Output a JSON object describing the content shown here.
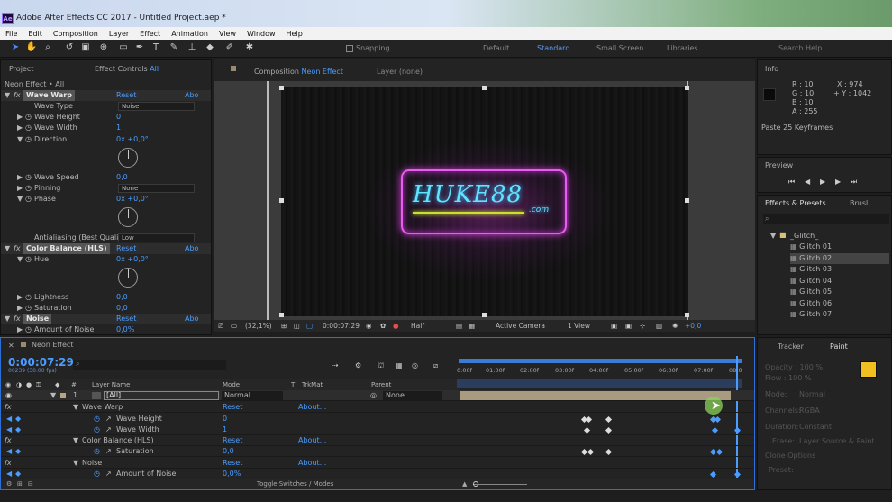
{
  "titlebar": {
    "title": "Adobe After Effects CC 2017 - Untitled Project.aep *",
    "logo": "Ae"
  },
  "menu": [
    "File",
    "Edit",
    "Composition",
    "Layer",
    "Effect",
    "Animation",
    "View",
    "Window",
    "Help"
  ],
  "toolbar": {
    "snapping": "Snapping",
    "workspaces": [
      "Default",
      "Standard",
      "Small Screen",
      "Libraries"
    ],
    "search": "Search Help"
  },
  "project_panel": {
    "tab_project": "Project",
    "tab_effect_controls": "Effect Controls",
    "effect_controls_target": "All",
    "breadcrumb": "Neon Effect • All"
  },
  "effects": {
    "wave_warp": {
      "name": "Wave Warp",
      "reset": "Reset",
      "about": "Abo",
      "wave_type_label": "Wave Type",
      "wave_type_value": "Noise",
      "wave_height_label": "Wave Height",
      "wave_height_value": "0",
      "wave_width_label": "Wave Width",
      "wave_width_value": "1",
      "direction_label": "Direction",
      "direction_value": "0x +0,0°",
      "wave_speed_label": "Wave Speed",
      "wave_speed_value": "0,0",
      "pinning_label": "Pinning",
      "pinning_value": "None",
      "phase_label": "Phase",
      "phase_value": "0x +0,0°",
      "antialiasing_label": "Antialiasing (Best Quali",
      "antialiasing_value": "Low"
    },
    "color_balance": {
      "name": "Color Balance (HLS)",
      "reset": "Reset",
      "about": "Abo",
      "hue_label": "Hue",
      "hue_value": "0x +0,0°",
      "lightness_label": "Lightness",
      "lightness_value": "0,0",
      "saturation_label": "Saturation",
      "saturation_value": "0,0"
    },
    "noise": {
      "name": "Noise",
      "reset": "Reset",
      "about": "Abo",
      "amount_label": "Amount of Noise",
      "amount_value": "0,0%"
    }
  },
  "composition": {
    "tab_label": "Composition",
    "comp_name": "Neon Effect",
    "layer_tab": "Layer (none)",
    "neon_text": "HUKE88",
    "neon_sub": ".com"
  },
  "viewer_bar": {
    "zoom": "(32,1%)",
    "timecode": "0:00:07:29",
    "resolution": "Half",
    "camera": "Active Camera",
    "view": "1 View",
    "exposure": "+0,0"
  },
  "info": {
    "tab": "Info",
    "r": "R : 10",
    "g": "G : 10",
    "b": "B : 10",
    "a": "A : 255",
    "x": "X : 974",
    "y": "+ Y : 1042",
    "status": "Paste 25 Keyframes"
  },
  "preview": {
    "tab": "Preview"
  },
  "effects_presets": {
    "tab": "Effects & Presets",
    "tab2": "Brusl",
    "folder": "_Glitch_",
    "items": [
      "Glitch 01",
      "Glitch 02",
      "Glitch 03",
      "Glitch 04",
      "Glitch 05",
      "Glitch 06",
      "Glitch 07"
    ],
    "selected": 1
  },
  "tracker_paint": {
    "tab_tracker": "Tracker",
    "tab_paint": "Paint",
    "opacity": "Opacity : 100 %",
    "flow": "Flow : 100 %",
    "mode": "Mode:",
    "mode_value": "Normal",
    "channels": "Channels:",
    "channels_value": "RGBA",
    "duration": "Duration:",
    "duration_value": "Constant",
    "erase": "Erase:",
    "erase_value": "Layer Source & Paint",
    "clone_options": "Clone Options",
    "preset": "Preset:",
    "brush_color": "#f0c020"
  },
  "timeline": {
    "tab": "Neon Effect",
    "timecode": "0:00:07:29",
    "frames": "00239 (30.00 fps)",
    "columns": {
      "layer_name": "Layer Name",
      "mode": "Mode",
      "t": "T",
      "trkmat": "TrkMat",
      "parent": "Parent"
    },
    "ruler": [
      "0:00f",
      "01:00f",
      "02:00f",
      "03:00f",
      "04:00f",
      "05:00f",
      "06:00f",
      "07:00f",
      "08:0"
    ],
    "layer": {
      "num": "1",
      "name": "[All]",
      "mode": "Normal",
      "parent": "None"
    },
    "rows": [
      {
        "name": "Wave Warp",
        "reset": "Reset",
        "about": "About..."
      },
      {
        "name": "Wave Height",
        "value": "0"
      },
      {
        "name": "Wave Width",
        "value": "1"
      },
      {
        "name": "Color Balance (HLS)",
        "reset": "Reset",
        "about": "About..."
      },
      {
        "name": "Saturation",
        "value": "0,0"
      },
      {
        "name": "Noise",
        "reset": "Reset",
        "about": "About..."
      },
      {
        "name": "Amount of Noise",
        "value": "0,0%"
      }
    ],
    "toggle": "Toggle Switches / Modes"
  }
}
